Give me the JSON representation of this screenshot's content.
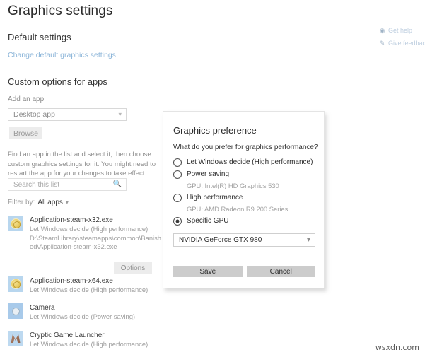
{
  "page": {
    "title": "Graphics settings",
    "sections": {
      "default_settings": "Default settings",
      "change_default_link": "Change default graphics settings",
      "custom_options": "Custom options for apps"
    },
    "add_an_app_label": "Add an app",
    "app_type_value": "Desktop app",
    "browse_label": "Browse",
    "helper_text": "Find an app in the list and select it, then choose custom graphics settings for it. You might need to restart the app for your changes to take effect.",
    "search_placeholder": "Search this list",
    "filter": {
      "label": "Filter by:",
      "value": "All apps"
    },
    "options_button": "Options"
  },
  "help_links": [
    {
      "icon": "help-question-icon",
      "label": "Get help"
    },
    {
      "icon": "feedback-icon",
      "label": "Give feedback"
    }
  ],
  "app_list": [
    {
      "icon": "steam-app-icon",
      "name": "Application-steam-x32.exe",
      "status": "Let Windows decide (High performance)",
      "path": "D:\\SteamLibrary\\steamapps\\common\\Banished\\Application-steam-x32.exe"
    },
    {
      "icon": "steam-app-icon",
      "name": "Application-steam-x64.exe",
      "status": "Let Windows decide (High performance)",
      "path": ""
    },
    {
      "icon": "camera-app-icon",
      "name": "Camera",
      "status": "Let Windows decide (Power saving)",
      "path": ""
    },
    {
      "icon": "cryptic-app-icon",
      "name": "Cryptic Game Launcher",
      "status": "Let Windows decide (High performance)",
      "path": ""
    }
  ],
  "dialog": {
    "title": "Graphics preference",
    "question": "What do you prefer for graphics performance?",
    "options": [
      {
        "label": "Let Windows decide (High performance)",
        "selected": false,
        "gpu": ""
      },
      {
        "label": "Power saving",
        "selected": false,
        "gpu": "GPU: Intel(R) HD Graphics 530"
      },
      {
        "label": "High performance",
        "selected": false,
        "gpu": "GPU: AMD Radeon R9 200 Series"
      },
      {
        "label": "Specific GPU",
        "selected": true,
        "gpu": ""
      }
    ],
    "gpu_select_value": "NVIDIA GeForce GTX 980",
    "save_label": "Save",
    "cancel_label": "Cancel"
  },
  "watermark": "wsxdn.com",
  "colors": {
    "link": "#8ab4d8",
    "button_face": "#ececec",
    "dialog_button": "#cccccc",
    "icon_tile": "#b9d7ef"
  }
}
